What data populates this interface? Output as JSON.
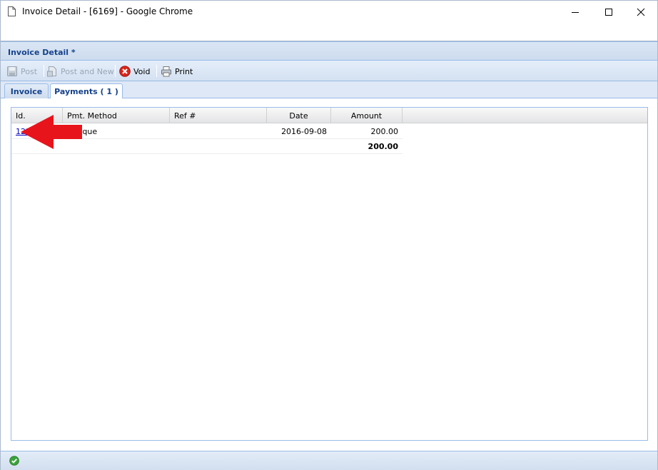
{
  "window": {
    "title": "Invoice Detail - [6169] - Google Chrome"
  },
  "panel": {
    "title": "Invoice Detail *"
  },
  "toolbar": {
    "post_label": "Post",
    "post_and_new_label": "Post and New",
    "void_label": "Void",
    "print_label": "Print"
  },
  "tabs": [
    {
      "label": "Invoice"
    },
    {
      "label": "Payments ( 1 )"
    }
  ],
  "grid": {
    "columns": [
      "Id.",
      "Pmt. Method",
      "Ref #",
      "Date",
      "Amount"
    ],
    "rows": [
      {
        "id": "122",
        "method": "Cheque",
        "ref": "",
        "date": "2016-09-08",
        "amount": "200.00"
      }
    ],
    "total": "200.00"
  },
  "colors": {
    "accent": "#15428b",
    "border": "#99bbe8",
    "annotation_arrow": "#e8141b"
  }
}
